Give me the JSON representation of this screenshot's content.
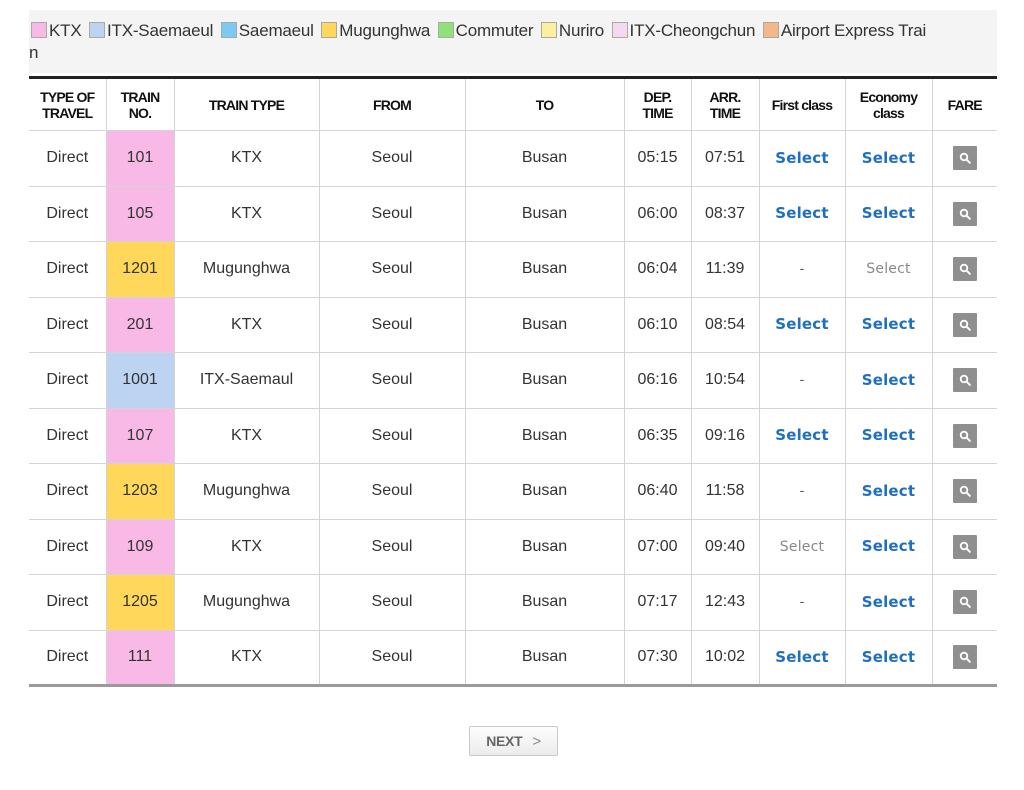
{
  "legend": [
    {
      "label": "KTX",
      "color": "#f9b9e6"
    },
    {
      "label": "ITX-Saemaeul",
      "color": "#bcd3f2"
    },
    {
      "label": "Saemaeul",
      "color": "#7ccaf2"
    },
    {
      "label": "Mugunghwa",
      "color": "#ffd75a"
    },
    {
      "label": "Commuter",
      "color": "#8fe27a"
    },
    {
      "label": "Nuriro",
      "color": "#fbf0a0"
    },
    {
      "label": "ITX-Cheongchun",
      "color": "#f5d9ee"
    },
    {
      "label": "Airport Express Trai",
      "color": "#f2b888"
    }
  ],
  "legend_wrap": "n",
  "headers": {
    "type_of_travel": [
      "TYPE OF",
      "TRAVEL"
    ],
    "train_no": [
      "TRAIN",
      "NO."
    ],
    "train_type": "TRAIN TYPE",
    "from": "FROM",
    "to": "TO",
    "dep_time": [
      "DEP.",
      "TIME"
    ],
    "arr_time": [
      "ARR.",
      "TIME"
    ],
    "first_class": "First class",
    "economy_class": [
      "Economy",
      "class"
    ],
    "fare": "FARE"
  },
  "rows": [
    {
      "travel": "Direct",
      "no": "101",
      "type": "KTX",
      "type_key": "ktx",
      "from": "Seoul",
      "to": "Busan",
      "dep": "05:15",
      "arr": "07:51",
      "first": "Select",
      "first_state": "active",
      "economy": "Select",
      "economy_state": "active"
    },
    {
      "travel": "Direct",
      "no": "105",
      "type": "KTX",
      "type_key": "ktx",
      "from": "Seoul",
      "to": "Busan",
      "dep": "06:00",
      "arr": "08:37",
      "first": "Select",
      "first_state": "active",
      "economy": "Select",
      "economy_state": "active"
    },
    {
      "travel": "Direct",
      "no": "1201",
      "type": "Mugunghwa",
      "type_key": "mug",
      "from": "Seoul",
      "to": "Busan",
      "dep": "06:04",
      "arr": "11:39",
      "first": "-",
      "first_state": "none",
      "economy": "Select",
      "economy_state": "disabled"
    },
    {
      "travel": "Direct",
      "no": "201",
      "type": "KTX",
      "type_key": "ktx",
      "from": "Seoul",
      "to": "Busan",
      "dep": "06:10",
      "arr": "08:54",
      "first": "Select",
      "first_state": "active",
      "economy": "Select",
      "economy_state": "active"
    },
    {
      "travel": "Direct",
      "no": "1001",
      "type": "ITX-Saemaul",
      "type_key": "itx",
      "from": "Seoul",
      "to": "Busan",
      "dep": "06:16",
      "arr": "10:54",
      "first": "-",
      "first_state": "none",
      "economy": "Select",
      "economy_state": "active"
    },
    {
      "travel": "Direct",
      "no": "107",
      "type": "KTX",
      "type_key": "ktx",
      "from": "Seoul",
      "to": "Busan",
      "dep": "06:35",
      "arr": "09:16",
      "first": "Select",
      "first_state": "active",
      "economy": "Select",
      "economy_state": "active"
    },
    {
      "travel": "Direct",
      "no": "1203",
      "type": "Mugunghwa",
      "type_key": "mug",
      "from": "Seoul",
      "to": "Busan",
      "dep": "06:40",
      "arr": "11:58",
      "first": "-",
      "first_state": "none",
      "economy": "Select",
      "economy_state": "active"
    },
    {
      "travel": "Direct",
      "no": "109",
      "type": "KTX",
      "type_key": "ktx",
      "from": "Seoul",
      "to": "Busan",
      "dep": "07:00",
      "arr": "09:40",
      "first": "Select",
      "first_state": "disabled",
      "economy": "Select",
      "economy_state": "active"
    },
    {
      "travel": "Direct",
      "no": "1205",
      "type": "Mugunghwa",
      "type_key": "mug",
      "from": "Seoul",
      "to": "Busan",
      "dep": "07:17",
      "arr": "12:43",
      "first": "-",
      "first_state": "none",
      "economy": "Select",
      "economy_state": "active"
    },
    {
      "travel": "Direct",
      "no": "111",
      "type": "KTX",
      "type_key": "ktx",
      "from": "Seoul",
      "to": "Busan",
      "dep": "07:30",
      "arr": "10:02",
      "first": "Select",
      "first_state": "active",
      "economy": "Select",
      "economy_state": "active"
    }
  ],
  "fare_icon": "magnifier-icon",
  "next_button": {
    "label": "NEXT",
    "icon": "chevron-right-icon",
    "glyph": ">"
  }
}
